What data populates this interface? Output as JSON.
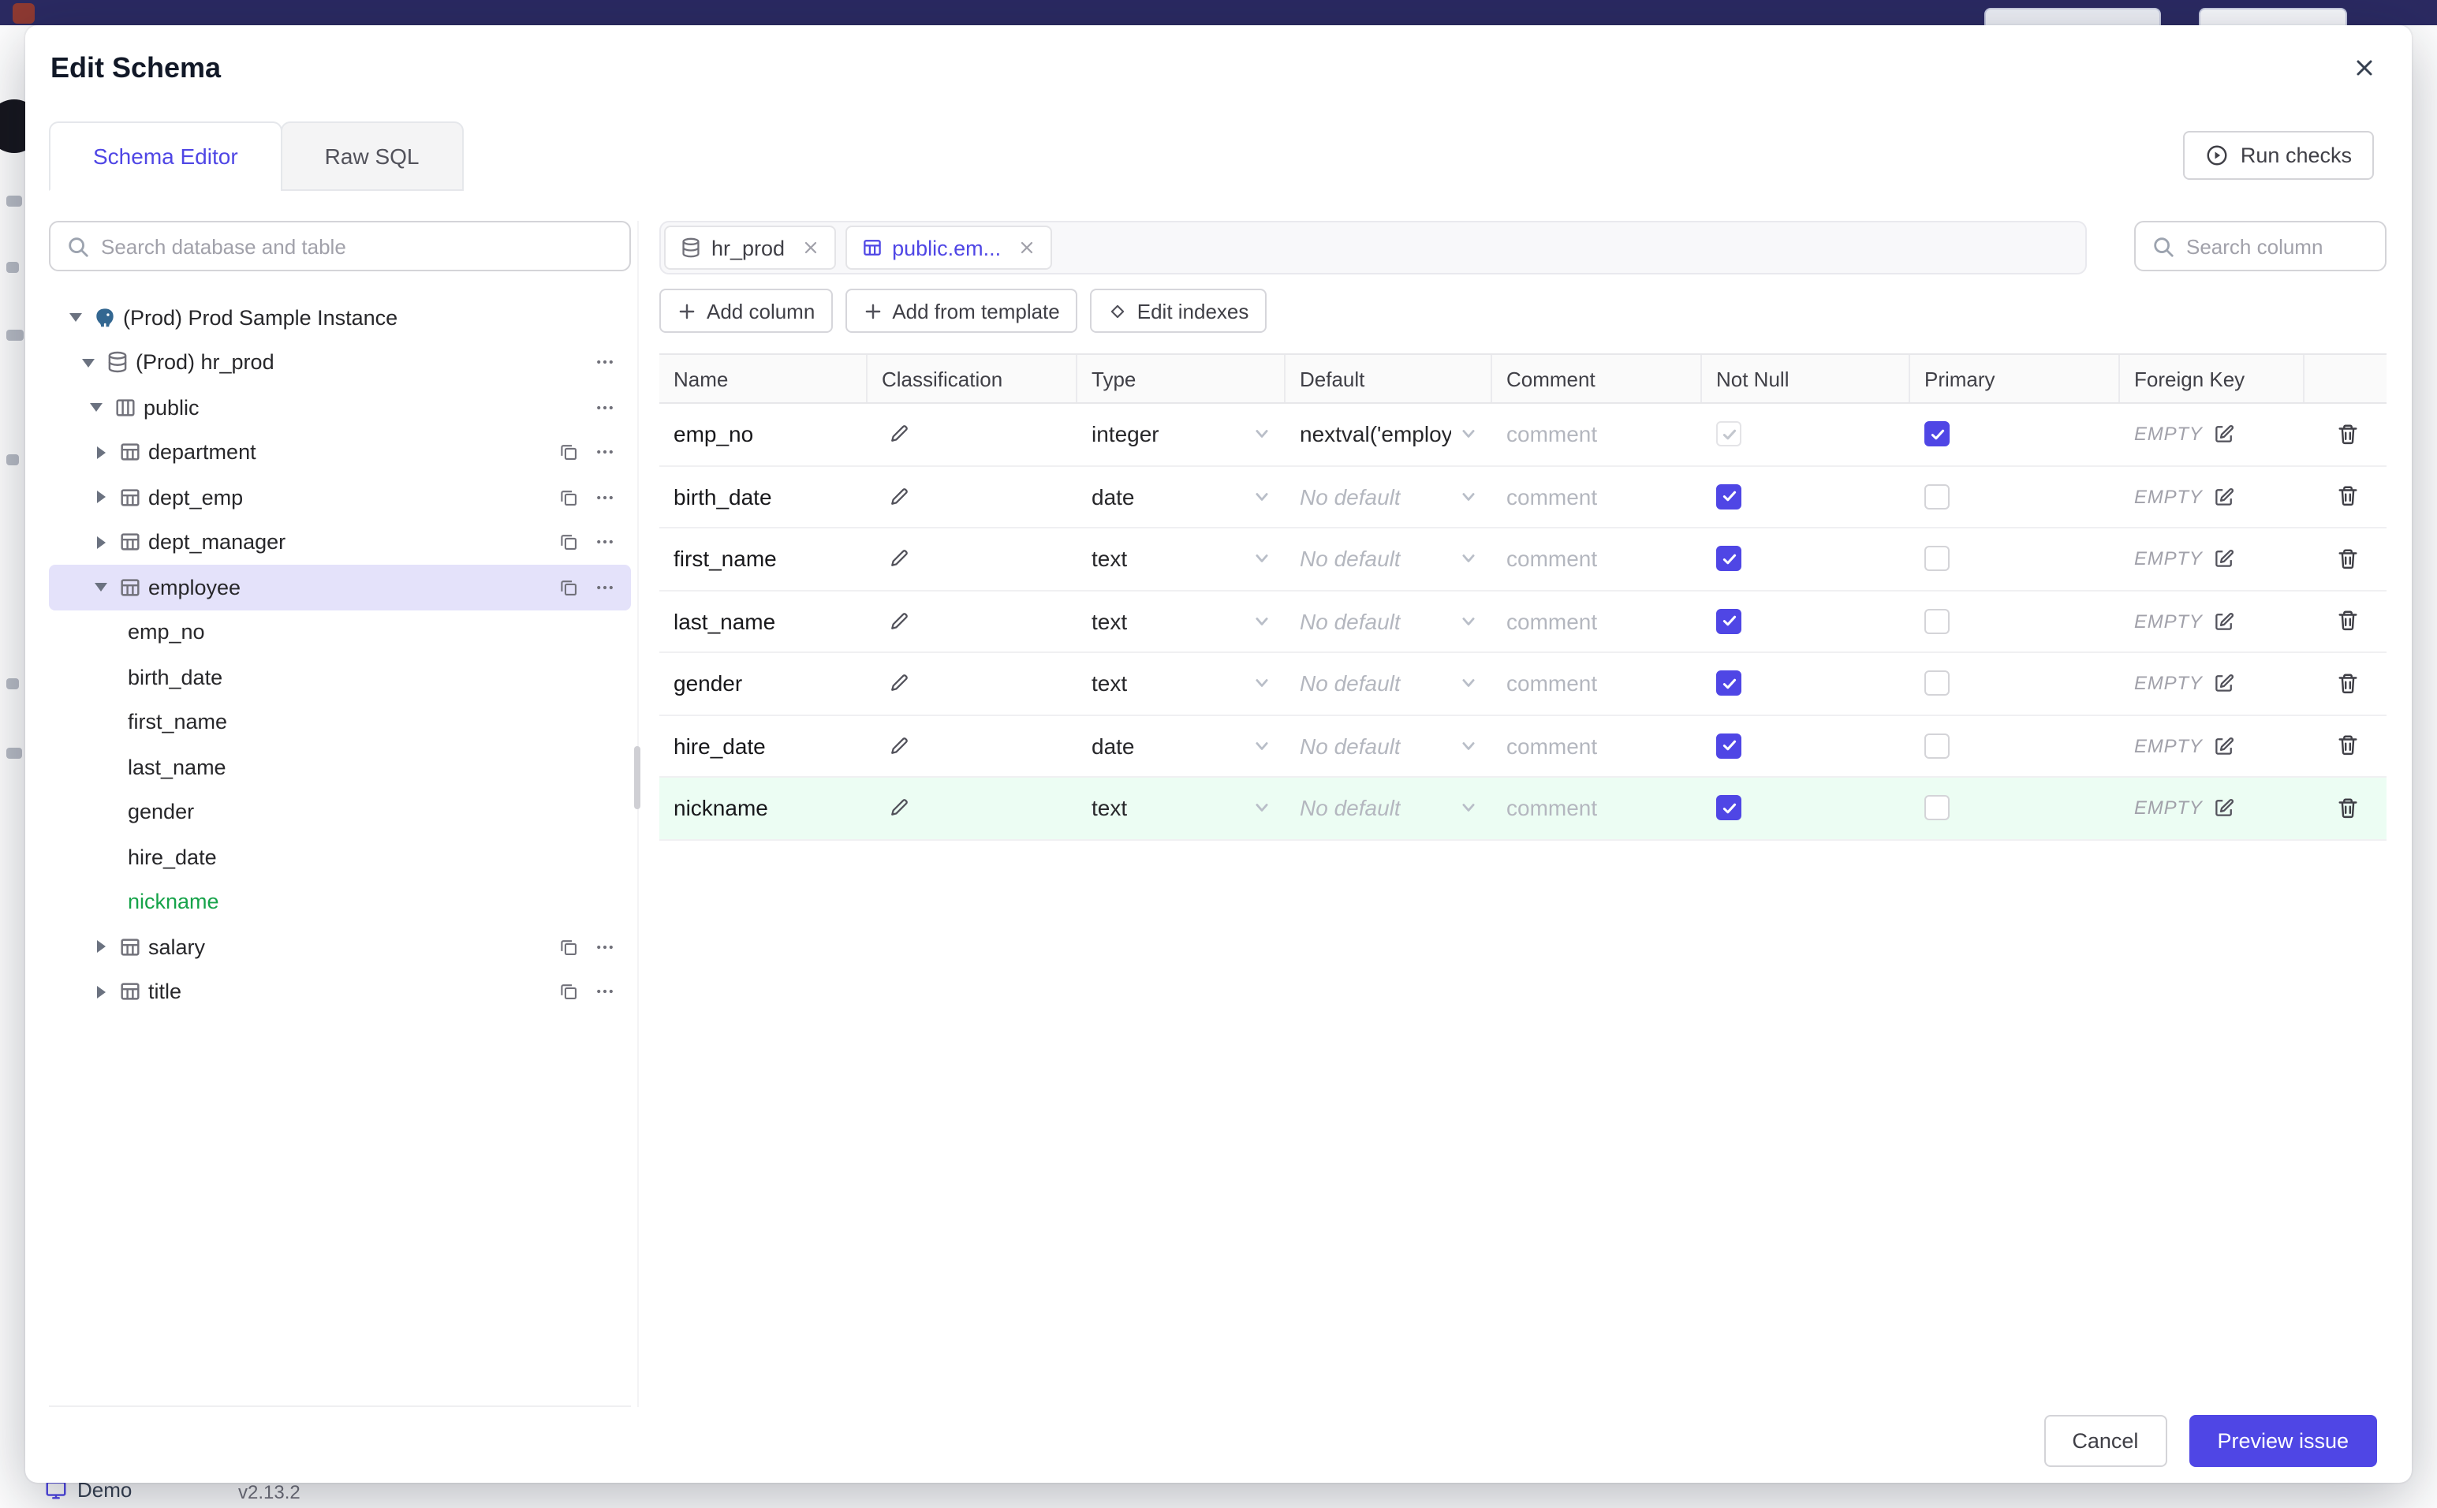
{
  "colors": {
    "accent": "#4f46e5",
    "topbar_bg": "#2b2a62",
    "selected_tree_row_bg": "#e4e2fa",
    "new_item_green": "#16a34a",
    "new_row_bg": "#ecfdf3"
  },
  "background": {
    "demo_label": "Demo",
    "version": "v2.13.2"
  },
  "modal": {
    "title": "Edit Schema",
    "run_checks_label": "Run checks",
    "tabs": [
      {
        "label": "Schema Editor",
        "active": true
      },
      {
        "label": "Raw SQL",
        "active": false
      }
    ],
    "sidebar": {
      "search_placeholder": "Search database and table",
      "tree": [
        {
          "kind": "instance",
          "label": "(Prod) Prod Sample Instance",
          "caret": "down"
        },
        {
          "kind": "database",
          "label": "(Prod) hr_prod",
          "caret": "down",
          "dots": true
        },
        {
          "kind": "schema",
          "label": "public",
          "caret": "down",
          "dots": true
        },
        {
          "kind": "table",
          "label": "department",
          "caret": "right",
          "copy": true,
          "dots": true
        },
        {
          "kind": "table",
          "label": "dept_emp",
          "caret": "right",
          "copy": true,
          "dots": true
        },
        {
          "kind": "table",
          "label": "dept_manager",
          "caret": "right",
          "copy": true,
          "dots": true
        },
        {
          "kind": "table",
          "label": "employee",
          "caret": "down",
          "copy": true,
          "dots": true,
          "selected": true
        },
        {
          "kind": "column",
          "label": "emp_no"
        },
        {
          "kind": "column",
          "label": "birth_date"
        },
        {
          "kind": "column",
          "label": "first_name"
        },
        {
          "kind": "column",
          "label": "last_name"
        },
        {
          "kind": "column",
          "label": "gender"
        },
        {
          "kind": "column",
          "label": "hire_date"
        },
        {
          "kind": "column",
          "label": "nickname",
          "green": true
        },
        {
          "kind": "table",
          "label": "salary",
          "caret": "right",
          "copy": true,
          "dots": true
        },
        {
          "kind": "table",
          "label": "title",
          "caret": "right",
          "copy": true,
          "dots": true
        }
      ]
    },
    "editor": {
      "tabs": [
        {
          "label": "hr_prod",
          "icon": "database",
          "active": false
        },
        {
          "label": "public.em...",
          "icon": "table",
          "active": true
        }
      ],
      "search_placeholder": "Search column",
      "actions": [
        {
          "label": "Add column",
          "icon": "plus"
        },
        {
          "label": "Add from template",
          "icon": "plus"
        },
        {
          "label": "Edit indexes",
          "icon": "diamond"
        }
      ],
      "table": {
        "headers": [
          "Name",
          "Classification",
          "Type",
          "Default",
          "Comment",
          "Not Null",
          "Primary",
          "Foreign Key"
        ],
        "rows": [
          {
            "name": "emp_no",
            "type": "integer",
            "default": "nextval('employ",
            "default_placeholder": false,
            "comment": "comment",
            "not_null": "disabled",
            "primary": "checked",
            "foreign_key": "EMPTY",
            "highlight": false
          },
          {
            "name": "birth_date",
            "type": "date",
            "default": "No default",
            "default_placeholder": true,
            "comment": "comment",
            "not_null": "checked",
            "primary": "unchecked",
            "foreign_key": "EMPTY",
            "highlight": false
          },
          {
            "name": "first_name",
            "type": "text",
            "default": "No default",
            "default_placeholder": true,
            "comment": "comment",
            "not_null": "checked",
            "primary": "unchecked",
            "foreign_key": "EMPTY",
            "highlight": false
          },
          {
            "name": "last_name",
            "type": "text",
            "default": "No default",
            "default_placeholder": true,
            "comment": "comment",
            "not_null": "checked",
            "primary": "unchecked",
            "foreign_key": "EMPTY",
            "highlight": false
          },
          {
            "name": "gender",
            "type": "text",
            "default": "No default",
            "default_placeholder": true,
            "comment": "comment",
            "not_null": "checked",
            "primary": "unchecked",
            "foreign_key": "EMPTY",
            "highlight": false
          },
          {
            "name": "hire_date",
            "type": "date",
            "default": "No default",
            "default_placeholder": true,
            "comment": "comment",
            "not_null": "checked",
            "primary": "unchecked",
            "foreign_key": "EMPTY",
            "highlight": false
          },
          {
            "name": "nickname",
            "type": "text",
            "default": "No default",
            "default_placeholder": true,
            "comment": "comment",
            "not_null": "checked",
            "primary": "unchecked",
            "foreign_key": "EMPTY",
            "highlight": true
          }
        ]
      }
    },
    "footer": {
      "cancel": "Cancel",
      "primary": "Preview issue"
    }
  }
}
